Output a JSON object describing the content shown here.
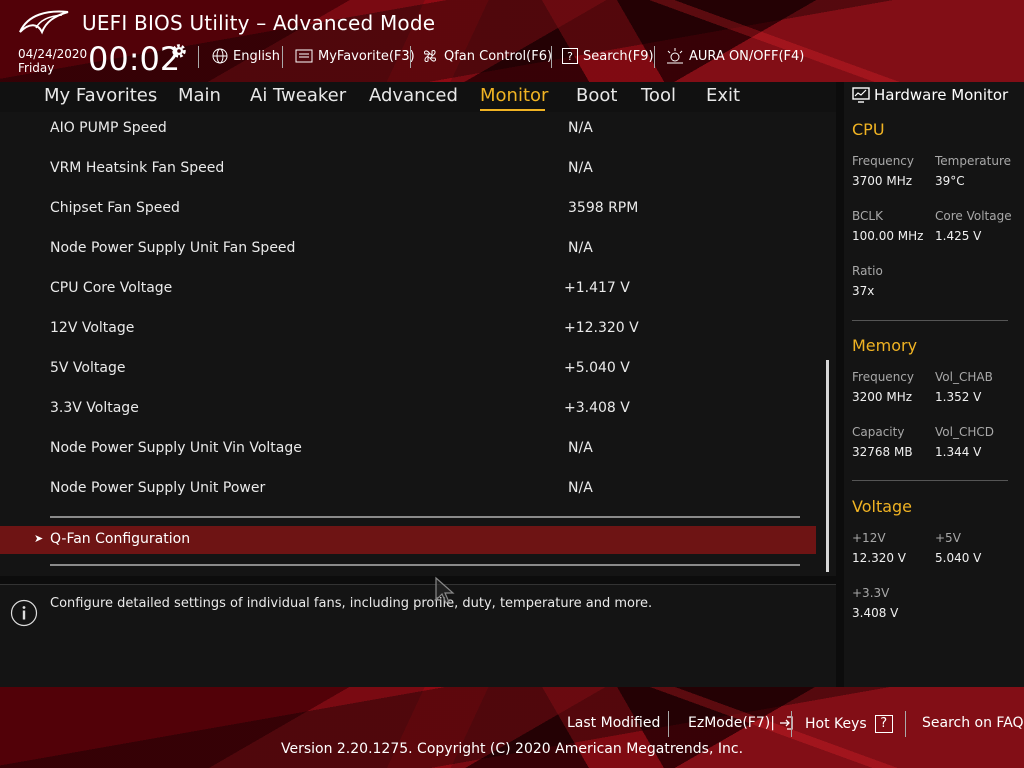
{
  "header": {
    "title": "UEFI BIOS Utility – Advanced Mode",
    "date": "04/24/2020",
    "day": "Friday",
    "time": "00:02",
    "items": [
      {
        "label": "English",
        "icon": "globe-icon"
      },
      {
        "label": "MyFavorite(F3)",
        "icon": "favorite-icon"
      },
      {
        "label": "Qfan Control(F6)",
        "icon": "fan-icon"
      },
      {
        "label": "Search(F9)",
        "icon": "search-icon"
      },
      {
        "label": "AURA ON/OFF(F4)",
        "icon": "aura-icon"
      }
    ]
  },
  "nav": {
    "tabs": [
      "My Favorites",
      "Main",
      "Ai Tweaker",
      "Advanced",
      "Monitor",
      "Boot",
      "Tool",
      "Exit"
    ],
    "active": "Monitor"
  },
  "main": {
    "rows": [
      {
        "label": "AIO PUMP Speed",
        "value": "N/A"
      },
      {
        "label": "VRM Heatsink Fan Speed",
        "value": "N/A"
      },
      {
        "label": "Chipset Fan Speed",
        "value": "3598 RPM"
      },
      {
        "label": "Node Power Supply Unit Fan Speed",
        "value": "N/A"
      },
      {
        "label": "CPU Core Voltage",
        "value": "+1.417 V"
      },
      {
        "label": "12V Voltage",
        "value": "+12.320 V"
      },
      {
        "label": "5V Voltage",
        "value": "+5.040 V"
      },
      {
        "label": "3.3V Voltage",
        "value": "+3.408 V"
      },
      {
        "label": "Node Power Supply Unit Vin Voltage",
        "value": "N/A"
      },
      {
        "label": "Node Power Supply Unit Power",
        "value": "N/A"
      }
    ],
    "submenu": "Q-Fan Configuration"
  },
  "help": {
    "text": "Configure detailed settings of individual fans, including profile, duty, temperature and more."
  },
  "hw": {
    "title": "Hardware Monitor",
    "cpu": {
      "heading": "CPU",
      "frequency_label": "Frequency",
      "frequency": "3700 MHz",
      "temperature_label": "Temperature",
      "temperature": "39°C",
      "bclk_label": "BCLK",
      "bclk": "100.00 MHz",
      "core_voltage_label": "Core Voltage",
      "core_voltage": "1.425 V",
      "ratio_label": "Ratio",
      "ratio": "37x"
    },
    "memory": {
      "heading": "Memory",
      "frequency_label": "Frequency",
      "frequency": "3200 MHz",
      "vol_chab_label": "Vol_CHAB",
      "vol_chab": "1.352 V",
      "capacity_label": "Capacity",
      "capacity": "32768 MB",
      "vol_chcd_label": "Vol_CHCD",
      "vol_chcd": "1.344 V"
    },
    "voltage": {
      "heading": "Voltage",
      "v12_label": "+12V",
      "v12": "12.320 V",
      "v5_label": "+5V",
      "v5": "5.040 V",
      "v33_label": "+3.3V",
      "v33": "3.408 V"
    }
  },
  "footer": {
    "last_modified": "Last Modified",
    "ezmode": "EzMode(F7)|",
    "hotkeys": "Hot Keys",
    "hotkeys_key": "?",
    "faq": "Search on FAQ",
    "copyright": "Version 2.20.1275. Copyright (C) 2020 American Megatrends, Inc."
  },
  "colors": {
    "accent": "#f0b323",
    "highlight_row": "#6e1414",
    "panel": "#141414"
  }
}
